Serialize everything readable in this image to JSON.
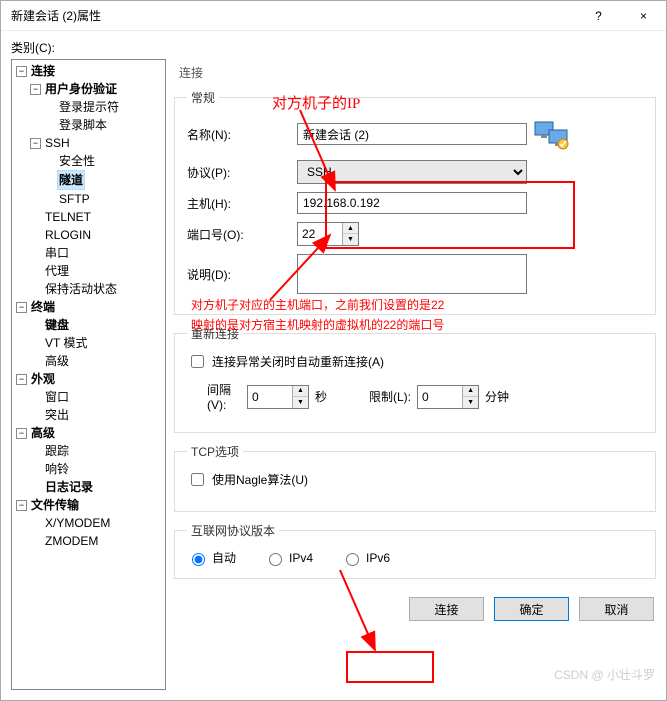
{
  "window": {
    "title": "新建会话 (2)属性",
    "help": "?",
    "close": "×"
  },
  "category_label": "类别(C):",
  "tree": {
    "connection": "连接",
    "user_auth": "用户身份验证",
    "login_prompt": "登录提示符",
    "login_script": "登录脚本",
    "ssh": "SSH",
    "security": "安全性",
    "tunnel": "隧道",
    "sftp": "SFTP",
    "telnet": "TELNET",
    "rlogin": "RLOGIN",
    "serial": "串口",
    "proxy": "代理",
    "keepalive": "保持活动状态",
    "terminal": "终端",
    "keyboard": "键盘",
    "vtmode": "VT 模式",
    "advanced1": "高级",
    "appearance": "外观",
    "window": "窗口",
    "highlight": "突出",
    "advanced2": "高级",
    "trace": "跟踪",
    "bell": "响铃",
    "logging": "日志记录",
    "filetransfer": "文件传输",
    "xymodem": "X/YMODEM",
    "zmodem": "ZMODEM"
  },
  "panel": {
    "heading": "连接",
    "general": {
      "legend": "常规",
      "name_label": "名称(N):",
      "name_value": "新建会话 (2)",
      "protocol_label": "协议(P):",
      "protocol_value": "SSH",
      "host_label": "主机(H):",
      "host_value": "192.168.0.192",
      "port_label": "端口号(O):",
      "port_value": "22",
      "desc_label": "说明(D):",
      "desc_value": ""
    },
    "reconnect": {
      "legend": "重新连接",
      "auto_label": "连接异常关闭时自动重新连接(A)",
      "interval_label": "间隔(V):",
      "interval_value": "0",
      "seconds": "秒",
      "limit_label": "限制(L):",
      "limit_value": "0",
      "minutes": "分钟"
    },
    "tcp": {
      "legend": "TCP选项",
      "nagle_label": "使用Nagle算法(U)"
    },
    "ipv": {
      "legend": "互联网协议版本",
      "auto": "自动",
      "ipv4": "IPv4",
      "ipv6": "IPv6"
    }
  },
  "annotations": {
    "ip_note": "对方机子的IP",
    "port_note1": "对方机子对应的主机端口，之前我们设置的是22",
    "port_note2": "映射的是对方宿主机映射的虚拟机的22的端口号"
  },
  "footer": {
    "connect": "连接",
    "ok": "确定",
    "cancel": "取消"
  },
  "watermark": "CSDN @ 小壮斗罗"
}
